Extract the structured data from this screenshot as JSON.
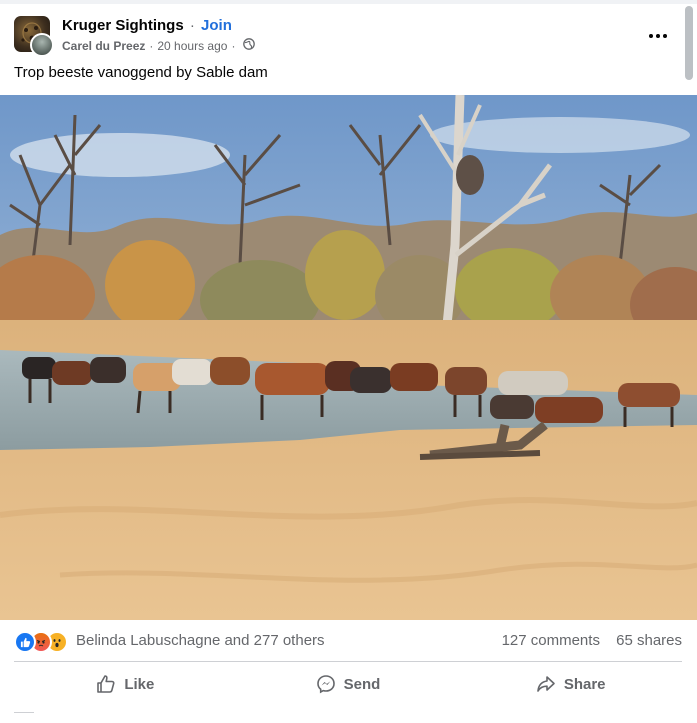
{
  "post": {
    "group_name": "Kruger Sightings",
    "separator": "·",
    "join_label": "Join",
    "author": "Carel du Preez",
    "timestamp": "20 hours ago",
    "caption": "Trop beeste vanoggend by Sable dam",
    "more_icon": "more-horizontal-icon",
    "privacy_icon": "globe-icon"
  },
  "photo": {
    "alt_icon": "photo-image",
    "sky_color": "#8fb1d4",
    "ground_color": "#e8c08a",
    "water_color": "#9fb2b8"
  },
  "reactions": {
    "icons": [
      "like-icon",
      "angry-icon",
      "wow-icon"
    ],
    "reactors_text": "Belinda Labuschagne and 277 others",
    "comments_text": "127 comments",
    "shares_text": "65 shares"
  },
  "actions": {
    "like_label": "Like",
    "send_label": "Send",
    "share_label": "Share"
  },
  "colors": {
    "link": "#216fdb",
    "secondary_text": "#65676b",
    "divider": "#ced0d4",
    "like_blue": "#1877f2"
  }
}
